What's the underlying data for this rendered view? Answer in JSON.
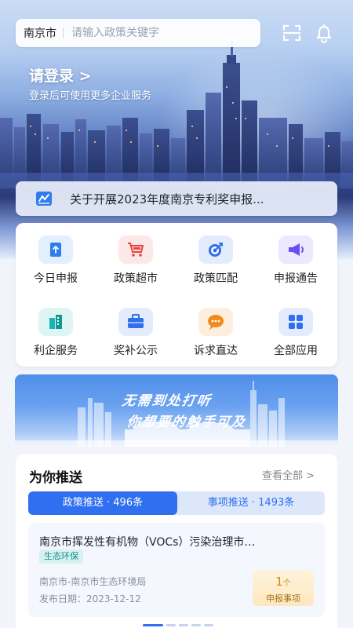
{
  "header": {
    "city": "南京市",
    "search_placeholder": "请输入政策关键字"
  },
  "login": {
    "title": "请登录 >",
    "subtitle": "登录后可使用更多企业服务"
  },
  "notice": {
    "text": "关于开展2023年度南京专利奖申报..."
  },
  "grid": {
    "items": [
      {
        "label": "今日申报",
        "icon": "upload-doc-icon",
        "color": "#2f7cf0"
      },
      {
        "label": "政策超市",
        "icon": "shopping-cart-icon",
        "color": "#e8423f"
      },
      {
        "label": "政策匹配",
        "icon": "target-icon",
        "color": "#2f6ff0"
      },
      {
        "label": "申报通告",
        "icon": "megaphone-icon",
        "color": "#6b4ef0"
      },
      {
        "label": "利企服务",
        "icon": "building-icon",
        "color": "#19b4b0"
      },
      {
        "label": "奖补公示",
        "icon": "briefcase-icon",
        "color": "#2f6ff0"
      },
      {
        "label": "诉求直达",
        "icon": "chat-bubble-icon",
        "color": "#f08a1e"
      },
      {
        "label": "全部应用",
        "icon": "apps-grid-icon",
        "color": "#2f6ff0"
      }
    ]
  },
  "banner": {
    "line1": "无需到处打听",
    "line2": "你想要的触手可及"
  },
  "push": {
    "title": "为你推送",
    "view_all": "查看全部 >",
    "tabs": [
      {
        "label": "政策推送 · 496条",
        "active": true
      },
      {
        "label": "事项推送 · 1493条",
        "active": false
      }
    ],
    "card": {
      "title": "南京市挥发性有机物（VOCs）污染治理市…",
      "tag": "生态环保",
      "dept": "南京市-南京市生态环境局",
      "date": "发布日期：2023-12-12",
      "count": "1",
      "count_unit": "个",
      "count_label": "申报事项"
    }
  },
  "pager": {
    "active_index": 0,
    "total": 5
  }
}
